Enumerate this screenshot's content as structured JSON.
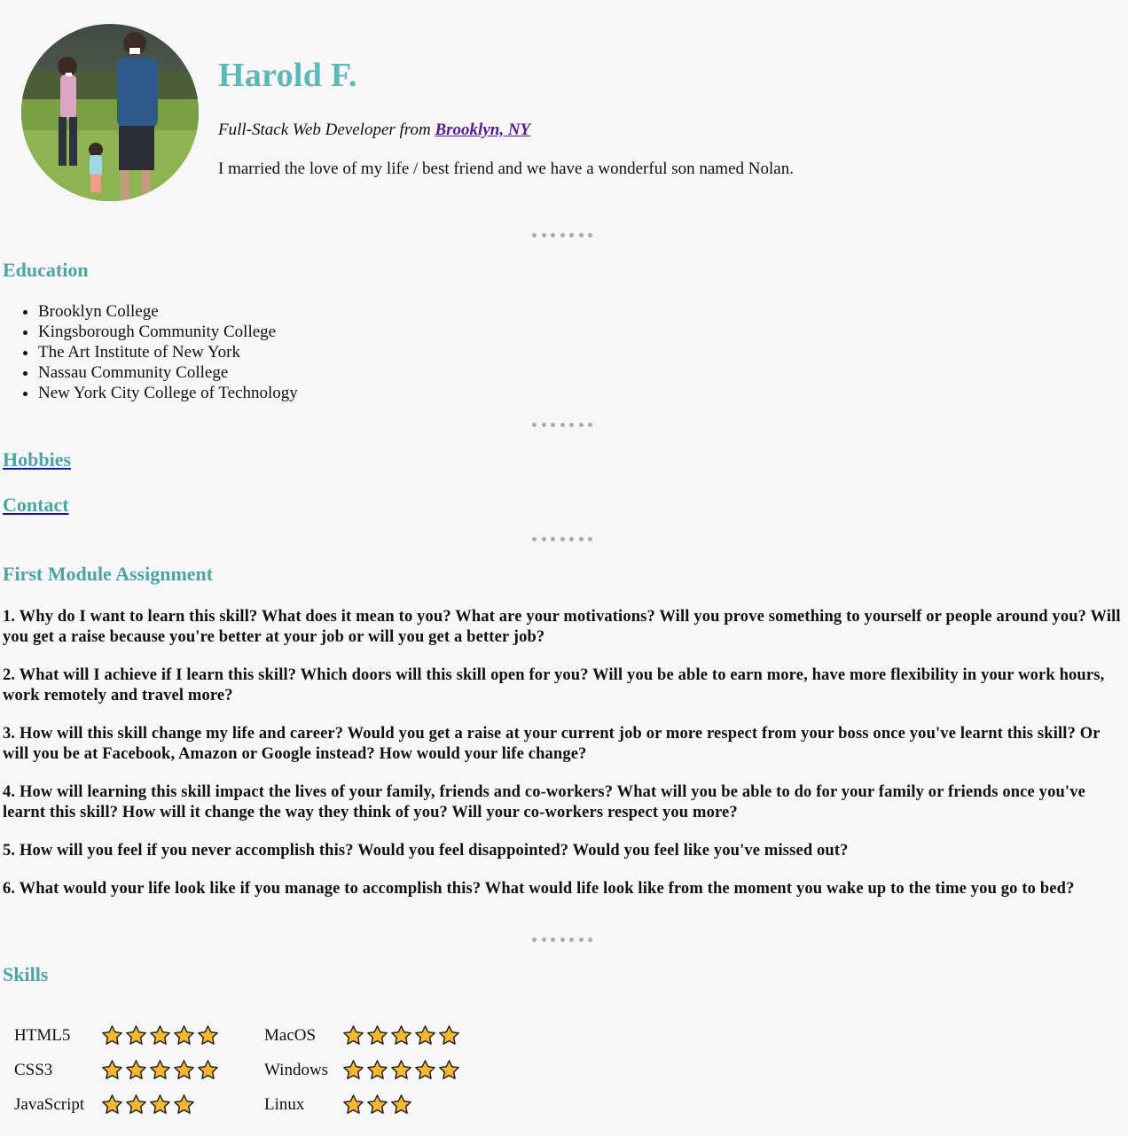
{
  "profile": {
    "name": "Harold F.",
    "subtitle_prefix": "Full-Stack Web Developer from",
    "location_link": "Brooklyn, NY",
    "bio": "I married the love of my life / best friend and we have a wonderful son named Nolan."
  },
  "education": {
    "title": "Education",
    "items": [
      "Brooklyn College",
      "Kingsborough Community College",
      "The Art Institute of New York",
      "Nassau Community College",
      "New York City College of Technology"
    ]
  },
  "links": {
    "hobbies": "Hobbies",
    "contact": "Contact"
  },
  "assignment": {
    "title": "First Module Assignment",
    "questions": [
      "1. Why do I want to learn this skill? What does it mean to you? What are your motivations? Will you prove something to yourself or people around you? Will you get a raise because you're better at your job or will you get a better job?",
      "2. What will I achieve if I learn this skill? Which doors will this skill open for you? Will you be able to earn more, have more flexibility in your work hours, work remotely and travel more?",
      "3. How will this skill change my life and career? Would you get a raise at your current job or more respect from your boss once you've learnt this skill? Or will you be at Facebook, Amazon or Google instead? How would your life change?",
      "4. How will learning this skill impact the lives of your family, friends and co-workers? What will you be able to do for your family or friends once you've learnt this skill? How will it change the way they think of you? Will your co-workers respect you more?",
      "5. How will you feel if you never accomplish this? Would you feel disappointed? Would you feel like you've missed out?",
      "6. What would your life look like if you manage to accomplish this? What would life look like from the moment you wake up to the time you go to bed?"
    ]
  },
  "skills": {
    "title": "Skills",
    "left": [
      {
        "name": "HTML5",
        "stars": 5
      },
      {
        "name": "CSS3",
        "stars": 5
      },
      {
        "name": "JavaScript",
        "stars": 4
      }
    ],
    "right": [
      {
        "name": "MacOS",
        "stars": 5
      },
      {
        "name": "Windows",
        "stars": 5
      },
      {
        "name": "Linux",
        "stars": 3
      }
    ],
    "star_icon": "star-icon",
    "star_color": "#f7b731"
  },
  "colors": {
    "heading": "#4fa3a3",
    "name": "#5fb8b8",
    "visited_link": "#551a8b"
  }
}
